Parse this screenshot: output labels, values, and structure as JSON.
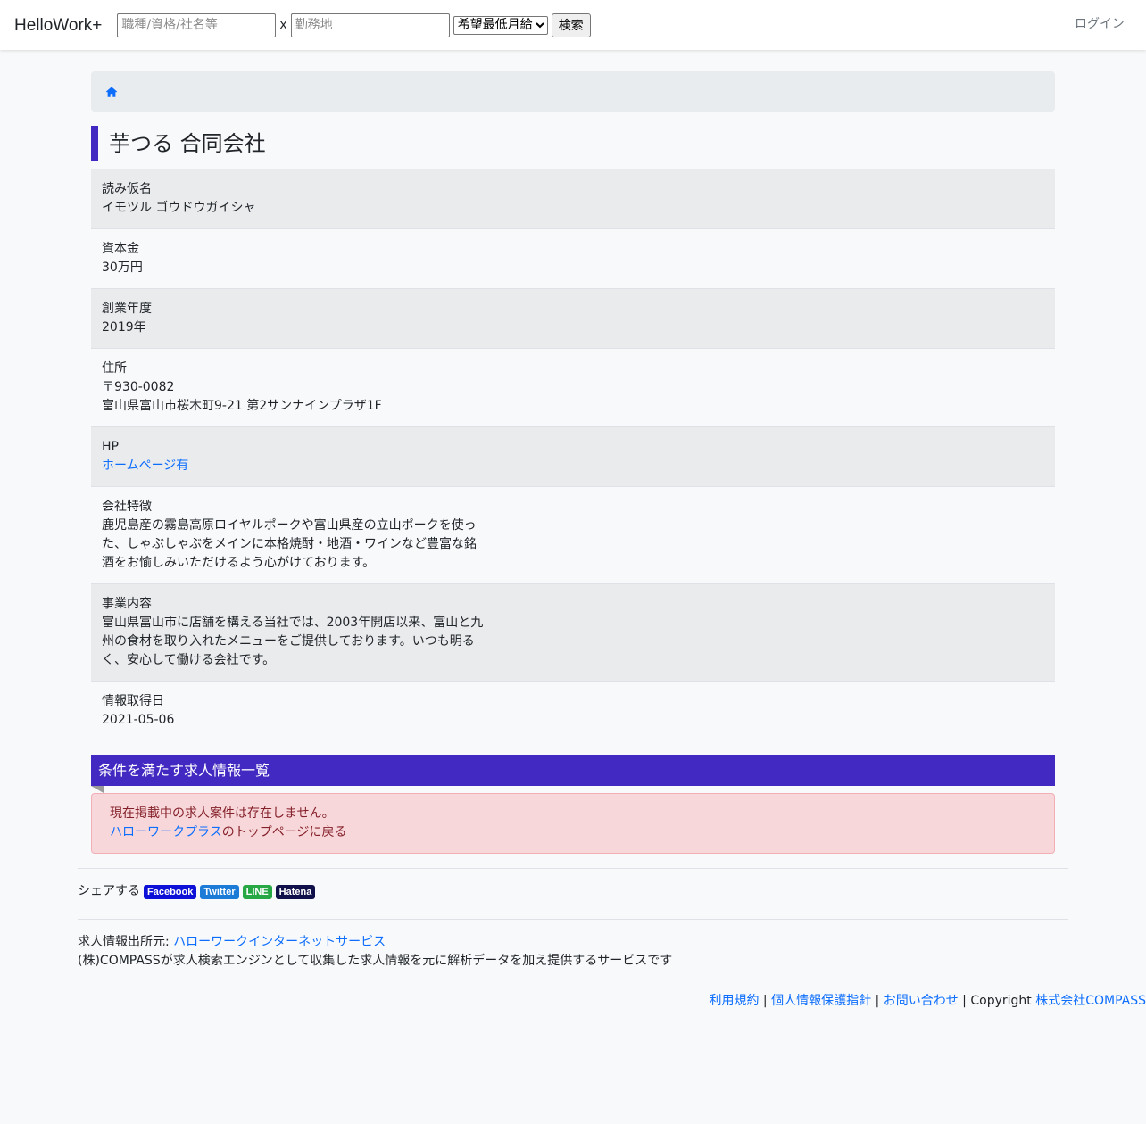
{
  "nav": {
    "brand": "HelloWork+",
    "keyword_placeholder": "職種/資格/社名等",
    "times": "x",
    "location_placeholder": "勤務地",
    "salary_select": "希望最低月給",
    "search_button": "検索",
    "login": "ログイン"
  },
  "breadcrumb": {
    "home_icon": "home-icon"
  },
  "company": {
    "name": "芋つる 合同会社",
    "fields": [
      {
        "label": "読み仮名",
        "value": "イモツル ゴウドウガイシャ"
      },
      {
        "label": "資本金",
        "value": "30万円"
      },
      {
        "label": "創業年度",
        "value": "2019年"
      },
      {
        "label": "住所",
        "value": "〒930-0082\n富山県富山市桜木町9-21 第2サンナインプラザ1F"
      },
      {
        "label": "HP",
        "value": "ホームページ有"
      },
      {
        "label": "会社特徴",
        "value": "鹿児島産の霧島高原ロイヤルポークや富山県産の立山ポークを使った、しゃぶしゃぶをメインに本格焼酎・地酒・ワインなど豊富な銘酒をお愉しみいただけるよう心がけております。"
      },
      {
        "label": "事業内容",
        "value": "富山県富山市に店舗を構える当社では、2003年開店以来、富山と九州の食材を取り入れたメニューをご提供しております。いつも明るく、安心して働ける会社です。"
      },
      {
        "label": "情報取得日",
        "value": "2021-05-06"
      }
    ]
  },
  "jobs": {
    "heading": "条件を満たす求人情報一覧",
    "empty_message": "現在掲載中の求人案件は存在しません。",
    "link_text": "ハローワークプラス",
    "link_suffix": "のトップページに戻る"
  },
  "share": {
    "label": "シェアする",
    "facebook": "Facebook",
    "twitter": "Twitter",
    "line": "LINE",
    "hatena": "Hatena"
  },
  "source": {
    "prefix": "求人情報出所元: ",
    "link": "ハローワークインターネットサービス",
    "description": "(株)COMPASSが求人検索エンジンとして収集した求人情報を元に解析データを加え提供するサービスです"
  },
  "footer": {
    "terms": "利用規約",
    "privacy": "個人情報保護指針",
    "contact": "お問い合わせ",
    "sep": " | ",
    "copyright": "Copyright ",
    "company": "株式会社COMPASS"
  },
  "colors": {
    "accent": "#4229c2",
    "link": "#0d6efd",
    "facebook": "#1877f2",
    "twitter": "#1d9bf0",
    "line": "#28a745",
    "hatena": "#10104a"
  }
}
